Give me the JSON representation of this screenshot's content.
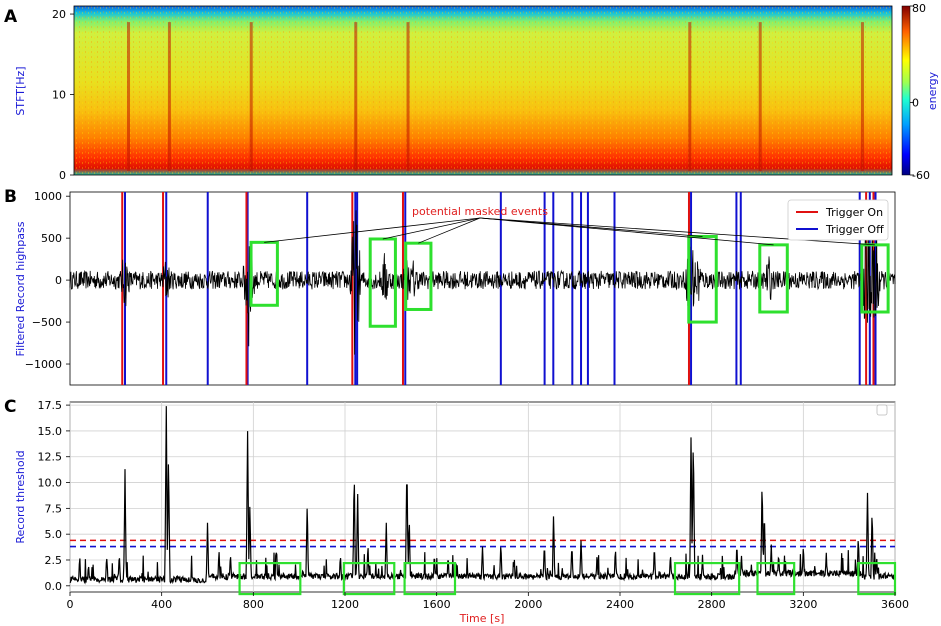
{
  "panels": {
    "a_label": "A",
    "b_label": "B",
    "c_label": "C"
  },
  "colors": {
    "trigger_on": "#e01010",
    "trigger_off": "#1010d0",
    "signal": "#000000",
    "highlight": "#2ee02e",
    "thr_on": "#e01010",
    "thr_off": "#1010d0"
  },
  "chart_data": [
    {
      "panel": "A",
      "type": "heatmap",
      "ylabel": "STFT[Hz]",
      "y_ticks": [
        "0",
        "10",
        "20"
      ],
      "ylim": [
        0,
        21
      ],
      "xlim": [
        0,
        3600
      ],
      "colorbar": {
        "label": "energy",
        "ticks": [
          "80",
          "0",
          "-60"
        ],
        "range": [
          -60,
          80
        ]
      },
      "energy_bands": [
        {
          "freq_from": 0,
          "freq_to": 1,
          "level": "high"
        },
        {
          "freq_from": 1,
          "freq_to": 5,
          "level": "medium-high"
        },
        {
          "freq_from": 5,
          "freq_to": 18,
          "level": "medium"
        },
        {
          "freq_from": 18,
          "freq_to": 21,
          "level": "low"
        }
      ],
      "event_times": [
        240,
        420,
        780,
        1240,
        1470,
        2710,
        3020,
        3470
      ]
    },
    {
      "panel": "B",
      "type": "line",
      "ylabel": "Filtered Record highpass",
      "y_ticks": [
        "1000",
        "500",
        "0",
        "−500",
        "−1000"
      ],
      "ylim": [
        -1250,
        1050
      ],
      "xlim": [
        0,
        3600
      ],
      "legend": {
        "position": "upper right",
        "items": [
          "Trigger On",
          "Trigger Off"
        ]
      },
      "annotation": "potential masked events",
      "trigger_on": [
        228,
        406,
        770,
        1232,
        1453,
        2701,
        3474,
        3506
      ],
      "trigger_off": [
        240,
        420,
        601,
        775,
        1035,
        1245,
        1253,
        1463,
        1880,
        2071,
        2109,
        2192,
        2230,
        2260,
        2376,
        2710,
        2908,
        2927,
        3446,
        3490,
        3515
      ],
      "highlight_boxes": [
        {
          "t0": 790,
          "t1": 905,
          "v0": -300,
          "v1": 450
        },
        {
          "t0": 1310,
          "t1": 1420,
          "v0": -550,
          "v1": 490
        },
        {
          "t0": 1465,
          "t1": 1575,
          "v0": -350,
          "v1": 440
        },
        {
          "t0": 2700,
          "t1": 2820,
          "v0": -500,
          "v1": 520
        },
        {
          "t0": 3010,
          "t1": 3130,
          "v0": -380,
          "v1": 420
        },
        {
          "t0": 3455,
          "t1": 3570,
          "v0": -380,
          "v1": 420
        }
      ],
      "events": [
        {
          "t": 240,
          "amp": 380
        },
        {
          "t": 420,
          "amp": 320
        },
        {
          "t": 780,
          "amp": 850
        },
        {
          "t": 1245,
          "amp": 1000
        },
        {
          "t": 1375,
          "amp": 380
        },
        {
          "t": 1470,
          "amp": 300
        },
        {
          "t": 1500,
          "amp": 280
        },
        {
          "t": 2710,
          "amp": 650
        },
        {
          "t": 2740,
          "amp": 380
        },
        {
          "t": 3050,
          "amp": 320
        },
        {
          "t": 3480,
          "amp": 900
        },
        {
          "t": 3510,
          "amp": 1000
        }
      ]
    },
    {
      "panel": "C",
      "type": "line",
      "ylabel": "Record threshold",
      "xlabel": "Time [s]",
      "y_ticks": [
        "17.5",
        "15.0",
        "12.5",
        "10.0",
        "7.5",
        "5.0",
        "2.5",
        "0.0"
      ],
      "x_ticks": [
        "0",
        "400",
        "800",
        "1200",
        "1600",
        "2000",
        "2400",
        "2800",
        "3200",
        "3600"
      ],
      "ylim": [
        -0.6,
        17.8
      ],
      "xlim": [
        0,
        3600
      ],
      "grid": true,
      "threshold_on": 4.4,
      "threshold_off": 3.8,
      "peaks": [
        {
          "t": 160,
          "v": 3.0
        },
        {
          "t": 215,
          "v": 3.2
        },
        {
          "t": 240,
          "v": 11.3
        },
        {
          "t": 420,
          "v": 17.4
        },
        {
          "t": 430,
          "v": 12.6
        },
        {
          "t": 600,
          "v": 6.1
        },
        {
          "t": 650,
          "v": 3.5
        },
        {
          "t": 700,
          "v": 3.2
        },
        {
          "t": 775,
          "v": 15.5
        },
        {
          "t": 785,
          "v": 7.9
        },
        {
          "t": 900,
          "v": 3.2
        },
        {
          "t": 1035,
          "v": 8.3
        },
        {
          "t": 1180,
          "v": 3.1
        },
        {
          "t": 1240,
          "v": 11.3
        },
        {
          "t": 1255,
          "v": 9.2
        },
        {
          "t": 1300,
          "v": 4.2
        },
        {
          "t": 1380,
          "v": 6.1
        },
        {
          "t": 1470,
          "v": 12.2
        },
        {
          "t": 1480,
          "v": 6.8
        },
        {
          "t": 1590,
          "v": 3.2
        },
        {
          "t": 1650,
          "v": 3.0
        },
        {
          "t": 1800,
          "v": 3.8
        },
        {
          "t": 1880,
          "v": 4.3
        },
        {
          "t": 2070,
          "v": 4.2
        },
        {
          "t": 2110,
          "v": 7.2
        },
        {
          "t": 2190,
          "v": 4.1
        },
        {
          "t": 2230,
          "v": 4.7
        },
        {
          "t": 2300,
          "v": 3.2
        },
        {
          "t": 2380,
          "v": 3.8
        },
        {
          "t": 2550,
          "v": 4.0
        },
        {
          "t": 2620,
          "v": 3.2
        },
        {
          "t": 2710,
          "v": 15.4
        },
        {
          "t": 2720,
          "v": 14.9
        },
        {
          "t": 2760,
          "v": 3.0
        },
        {
          "t": 2910,
          "v": 4.3
        },
        {
          "t": 2930,
          "v": 3.1
        },
        {
          "t": 3020,
          "v": 10.5
        },
        {
          "t": 3030,
          "v": 7.5
        },
        {
          "t": 3060,
          "v": 4.0
        },
        {
          "t": 3200,
          "v": 4.1
        },
        {
          "t": 3300,
          "v": 3.2
        },
        {
          "t": 3440,
          "v": 5.0
        },
        {
          "t": 3480,
          "v": 9.0
        },
        {
          "t": 3500,
          "v": 7.6
        },
        {
          "t": 3520,
          "v": 3.0
        }
      ],
      "highlight_boxes": [
        {
          "t0": 740,
          "t1": 1005,
          "v0": -0.8,
          "v1": 2.2
        },
        {
          "t0": 1195,
          "t1": 1415,
          "v0": -0.8,
          "v1": 2.2
        },
        {
          "t0": 1460,
          "t1": 1680,
          "v0": -0.8,
          "v1": 2.2
        },
        {
          "t0": 2640,
          "t1": 2920,
          "v0": -0.8,
          "v1": 2.2
        },
        {
          "t0": 3000,
          "t1": 3160,
          "v0": -0.8,
          "v1": 2.2
        },
        {
          "t0": 3440,
          "t1": 3600,
          "v0": -0.8,
          "v1": 2.2
        }
      ]
    }
  ]
}
